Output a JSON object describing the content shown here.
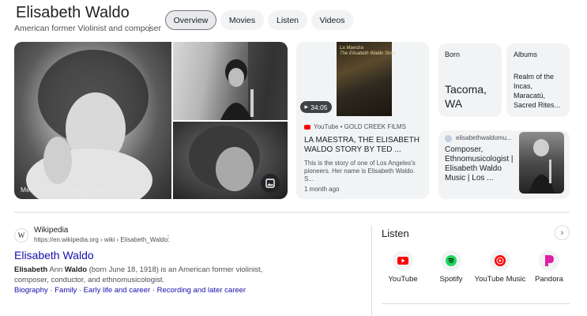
{
  "header": {
    "title": "Elisabeth Waldo",
    "subtitle": "American former Violinist and composer",
    "tabs": [
      {
        "label": "Overview",
        "active": true
      },
      {
        "label": "Movies"
      },
      {
        "label": "Listen"
      },
      {
        "label": "Videos"
      }
    ]
  },
  "images": {
    "main_caption": "Memórias Cinematográficas"
  },
  "video": {
    "thumb_title": "La Maestra\nThe Elisabeth Waldo Story",
    "duration": "34:05",
    "source": "YouTube • GOLD CREEK FILMS",
    "title": "LA MAESTRA, THE ELISABETH WALDO STORY BY TED ...",
    "description": "This is the story of one of Los Angeles's pioneers. Her name is Elisabeth Waldo. S...",
    "age": "1 month ago"
  },
  "born": {
    "label": "Born",
    "value": "Tacoma, WA"
  },
  "albums": {
    "label": "Albums",
    "value": "Realm of the Incas, Maracatú, Sacred Rites..."
  },
  "site": {
    "domain": "elisabethwaldomu...",
    "title": "Composer, Ethnomusicologist | Elisabeth Waldo Music | Los ..."
  },
  "wiki": {
    "favicon": "W",
    "site": "Wikipedia",
    "url": "https://en.wikipedia.org › wiki › Elisabeth_Waldo",
    "title": "Elisabeth Waldo",
    "snippet_name1": "Elisabeth",
    "snippet_mid": " Ann ",
    "snippet_name2": "Waldo",
    "snippet_rest": " (born June 18, 1918) is an American former violinist, composer, conductor, and ethnomusicologist.",
    "links": [
      "Biography",
      "Family",
      "Early life and career",
      "Recording and later career"
    ],
    "sep": " · "
  },
  "listen": {
    "title": "Listen",
    "services": [
      {
        "label": "YouTube",
        "icon": "youtube-icon",
        "color": "#ff0000"
      },
      {
        "label": "Spotify",
        "icon": "spotify-icon",
        "color": "#1ed760"
      },
      {
        "label": "YouTube Music",
        "icon": "youtube-music-icon",
        "color": "#ff0000"
      },
      {
        "label": "Pandora",
        "icon": "pandora-icon",
        "color": "#e11ea5"
      }
    ]
  },
  "colors": {
    "link": "#1a0dab",
    "chip_bg": "#f1f3f4",
    "text_secondary": "#4d5156"
  }
}
